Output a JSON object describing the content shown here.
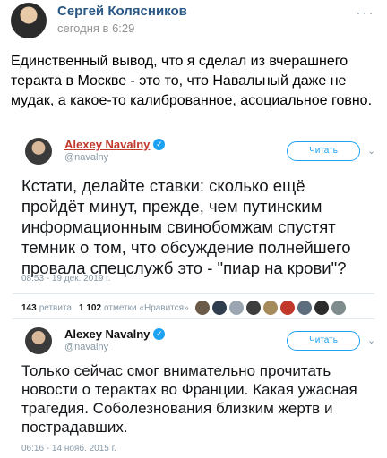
{
  "post": {
    "author": "Сергей Колясников",
    "time": "сегодня в 6:29",
    "more": "···",
    "text": "Единственный вывод, что я сделал из вчерашнего теракта в Москве - это то, что Навальный даже не мудак, а какое-то калиброванное, асоциальное говно."
  },
  "tweets": [
    {
      "name": "Alexey Navalny",
      "handle": "@navalny",
      "follow_label": "Читать",
      "text": "Кстати, делайте ставки: сколько ещё пройдёт минут, прежде, чем путинским информационным свинобомжам спустят темник о том, что обсуждение полнейшего провала спецслужб это - \"пиар на крови\"?",
      "date": "08:53 - 19 дек. 2019 г."
    },
    {
      "name": "Alexey Navalny",
      "handle": "@navalny",
      "follow_label": "Читать",
      "text": "Только сейчас смог внимательно прочитать новости о терактах во Франции. Какая ужасная трагедия. Соболезнования близким жертв и пострадавших.",
      "date": "06:16 - 14 нояб. 2015 г."
    }
  ],
  "stats": {
    "retweets_count": "143",
    "retweets_label": "ретвита",
    "likes_count": "1 102",
    "likes_label": "отметки «Нравится»",
    "liker_colors": [
      "#6b5a4a",
      "#2f3d4f",
      "#9aa6b2",
      "#3d3d3d",
      "#a58a5c",
      "#c0392b",
      "#5d6d7e",
      "#2c2c2c",
      "#7f8c8d"
    ]
  },
  "icons": {
    "verified": "verified-badge-icon",
    "chevron": "chevron-down-icon"
  }
}
